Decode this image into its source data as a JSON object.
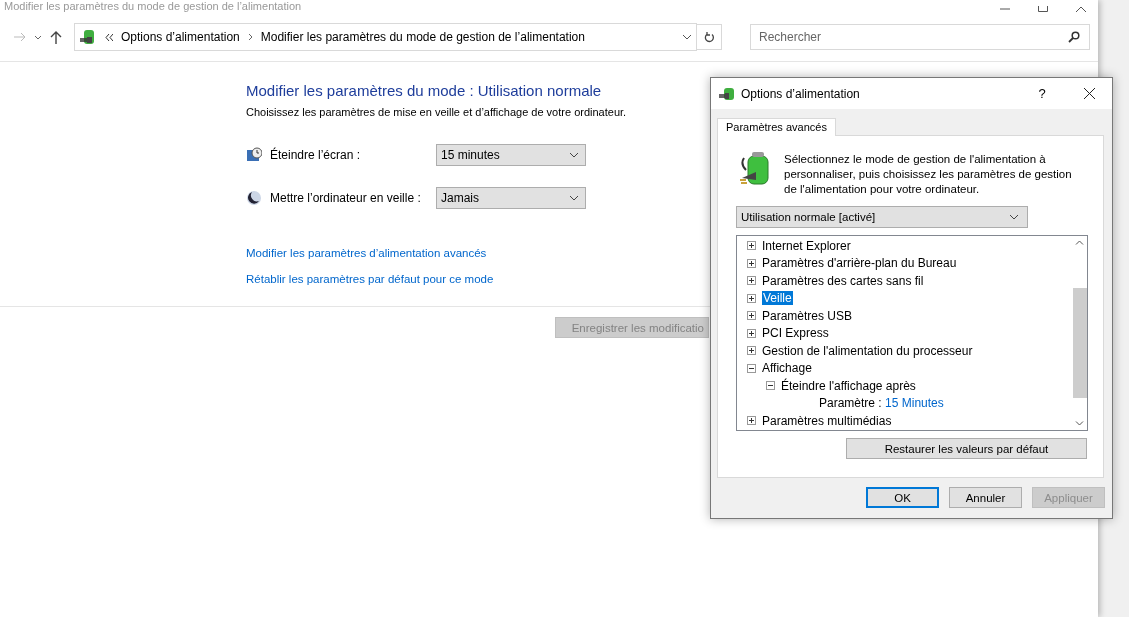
{
  "window": {
    "title": "Modifier les paramètres du mode de gestion de l’alimentation"
  },
  "address_bar": {
    "crumbs": [
      "Options d’alimentation",
      "Modifier les paramètres du mode de gestion de l’alimentation"
    ]
  },
  "search": {
    "placeholder": "Rechercher"
  },
  "content": {
    "heading": "Modifier les paramètres du mode : Utilisation normale",
    "subtitle": "Choisissez les paramètres de mise en veille et d’affichage de votre ordinateur.",
    "settings": [
      {
        "kind": "display",
        "label": "Éteindre l’écran :",
        "value": "15 minutes"
      },
      {
        "kind": "sleep",
        "label": "Mettre l’ordinateur en veille :",
        "value": "Jamais"
      }
    ],
    "links": [
      "Modifier les paramètres d’alimentation avancés",
      "Rétablir les paramètres par défaut pour ce mode"
    ],
    "save_button": {
      "label": "Enregistrer les modificatio",
      "disabled": true
    }
  },
  "dialog": {
    "title": "Options d’alimentation",
    "help": "?",
    "tabs": [
      {
        "label": "Paramètres avancés",
        "selected": true
      }
    ],
    "intro": "Sélectionnez le mode de gestion de l'alimentation à personnaliser, puis choisissez les paramètres de gestion de l'alimentation pour votre ordinateur.",
    "plan": "Utilisation normale [activé]",
    "tree": [
      {
        "kind": "group",
        "label": "Internet Explorer",
        "expanded": false,
        "selected": false
      },
      {
        "kind": "group",
        "label": "Paramètres d'arrière-plan du Bureau",
        "expanded": false,
        "selected": false
      },
      {
        "kind": "group",
        "label": "Paramètres des cartes sans fil",
        "expanded": false,
        "selected": false
      },
      {
        "kind": "group",
        "label": "Veille",
        "expanded": false,
        "selected": true
      },
      {
        "kind": "group",
        "label": "Paramètres USB",
        "expanded": false,
        "selected": false
      },
      {
        "kind": "group",
        "label": "PCI Express",
        "expanded": false,
        "selected": false
      },
      {
        "kind": "group",
        "label": "Gestion de l'alimentation du processeur",
        "expanded": false,
        "selected": false
      },
      {
        "kind": "group",
        "label": "Affichage",
        "expanded": true,
        "selected": false,
        "children": [
          {
            "kind": "group",
            "label": "Éteindre l'affichage après",
            "expanded": true,
            "selected": false,
            "children": [
              {
                "kind": "setting",
                "label": "Paramètre :",
                "value": "15 Minutes",
                "selected": false
              }
            ]
          }
        ]
      },
      {
        "kind": "group",
        "label": "Paramètres multimédias",
        "expanded": false,
        "selected": false
      }
    ],
    "restore_button": "Restaurer les valeurs par défaut",
    "buttons": [
      {
        "label": "OK",
        "default": true,
        "disabled": false
      },
      {
        "label": "Annuler",
        "default": false,
        "disabled": false
      },
      {
        "label": "Appliquer",
        "default": false,
        "disabled": true
      }
    ]
  }
}
